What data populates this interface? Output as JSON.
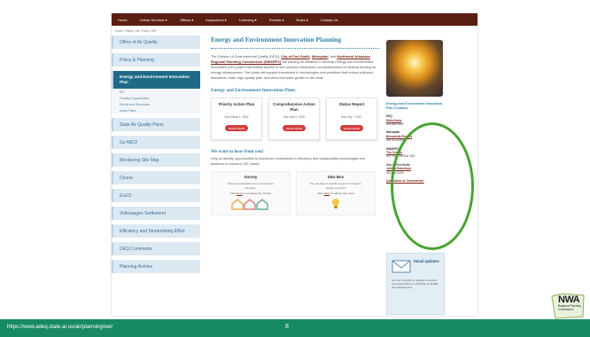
{
  "nav": {
    "items": [
      "Home",
      "Online Services ▾",
      "Offices ▾",
      "Inspections ▾",
      "Licensing ▾",
      "Permits ▾",
      "Rules ▾",
      "Contact Us"
    ]
  },
  "breadcrumb": "Home / Offices / Air / Policy / EEI",
  "sidebar": {
    "office": "Office of Air Quality",
    "policy": "Policy & Planning",
    "active": "Energy and Environment Innovation Plan",
    "sub": [
      "EEI",
      "Funding Opportunities",
      "Events and Resources",
      "Action Plans"
    ],
    "items": [
      "State Air Quality Plans",
      "Go NEO!",
      "Monitoring Site Map",
      "Ozone",
      "ELEO",
      "Volkswagen Settlement",
      "Efficiency and Streamlining Effort",
      "DEQ Comments",
      "Planning Archive"
    ]
  },
  "main": {
    "title": "Energy and Environment Innovation Planning",
    "intro_a": "The Division of Environmental Quality (DEQ), ",
    "link1": "City of Fort Smith",
    "intro_b": ", ",
    "link2": "Metroplan",
    "intro_c": ", and ",
    "link3": "Northwest Arkansas Regional Planning Commission (NWARPC)",
    "intro_d": " are leading an initiative to develop Energy and Environment Innovation (EEI) plans that enable access to and advance Arkansas's competitiveness for federal funding for energy infrastructure. The plans will support investment in technologies and practices that reduce pollutant emissions, lower high-quality jobs, and drive economic growth in the state.",
    "plans_title": "Energy and Environment Innovation Plans",
    "cards": [
      {
        "title": "Priority Action Plan",
        "date": "Due March 1, 2024",
        "button": "LEARN MORE"
      },
      {
        "title": "Comprehensive Action Plan",
        "date": "Due July 5, 2025",
        "button": "LEARN MORE"
      },
      {
        "title": "Status Report",
        "date": "Due July 7, 2027",
        "button": "LEARN MORE"
      }
    ],
    "hear_title": "We want to hear from you!",
    "hear_text": "Help us identify opportunities to incentivize investments in efficiency and sustainability technologies and practices to include in EEI plans!",
    "survey": {
      "title": "Survey",
      "text": "Help us understand your community's priorities.",
      "link_pre": "Click ",
      "link": "here",
      "link_post": " to complete the survey!"
    },
    "ideabox": {
      "title": "Idea Box",
      "text": "Do you have a specific project or program design concept?",
      "link_pre": "Click ",
      "link": "here",
      "link_post": " to submit your idea!"
    }
  },
  "contacts": {
    "title": "Energy and Environment Innovation Plan Contacts",
    "groups": [
      {
        "org": "DEQ",
        "name": "Erika Drake",
        "phone": "501.682.0542"
      },
      {
        "org": "Metroplan",
        "name": "Bernadette Rhodes",
        "phone": "501.372.3300"
      },
      {
        "org": "NWARPC",
        "name": "Tim Conklin",
        "phone": "479.751.7125 Ext. 103"
      },
      {
        "org": "City of Fort Smith",
        "name": "Joshua Robertson",
        "phone": "479.784.2203"
      }
    ],
    "questions": "Questions or Comments?"
  },
  "email": {
    "title": "Email Updates",
    "text": "Join our email list for updates on events and opportunities to contribute to the EEI plan development."
  },
  "footer": {
    "url": "https://www.adeq.state.ar.us/air/planning/eei/",
    "page": "8"
  },
  "logo": {
    "text": "NWA",
    "sub": "Regional Planning Commission"
  },
  "colors": {
    "nav_bg": "#5b1e12",
    "accent": "#2e82a8",
    "footer_bg": "#178a62",
    "annotation": "#4aa333",
    "button": "#d33d3d"
  }
}
